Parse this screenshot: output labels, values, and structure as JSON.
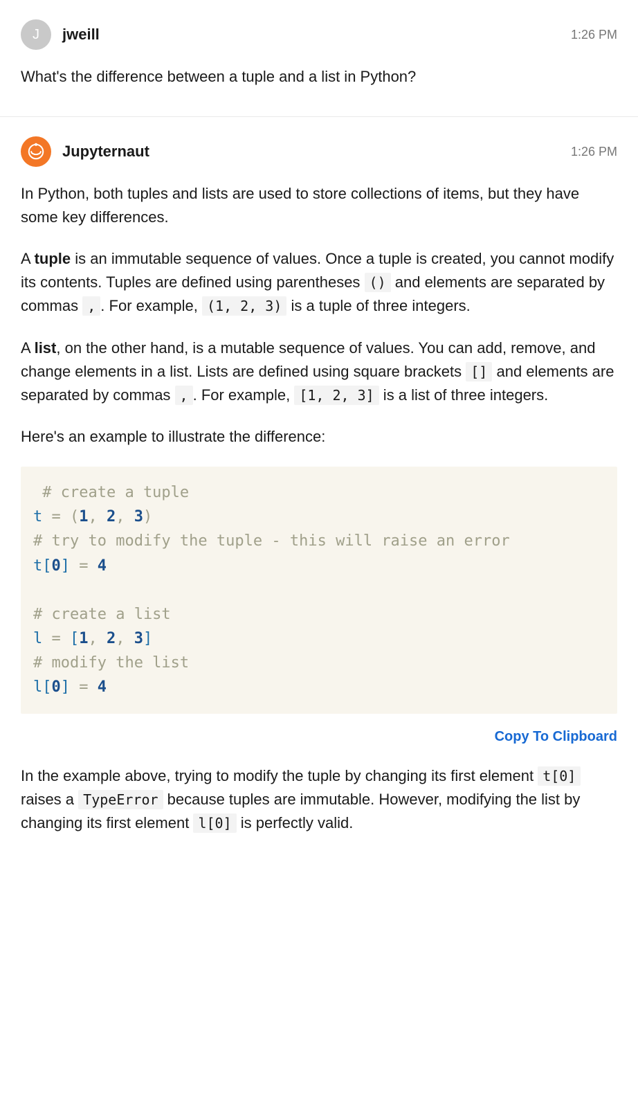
{
  "messages": [
    {
      "avatar_letter": "J",
      "username": "jweill",
      "timestamp": "1:26 PM",
      "question": "What's the difference between a tuple and a list in Python?"
    },
    {
      "username": "Jupyternaut",
      "timestamp": "1:26 PM",
      "p1": "In Python, both tuples and lists are used to store collections of items, but they have some key differences.",
      "p2a": "A ",
      "p2b": "tuple",
      "p2c": " is an immutable sequence of values. Once a tuple is created, you cannot modify its contents. Tuples are defined using parentheses ",
      "p2_code1": "()",
      "p2d": " and elements are separated by commas ",
      "p2_code2": ",",
      "p2e": ". For example, ",
      "p2_code3": "(1, 2, 3)",
      "p2f": " is a tuple of three integers.",
      "p3a": "A ",
      "p3b": "list",
      "p3c": ", on the other hand, is a mutable sequence of values. You can add, remove, and change elements in a list. Lists are defined using square brackets ",
      "p3_code1": "[]",
      "p3d": " and elements are separated by commas ",
      "p3_code2": ",",
      "p3e": ". For example, ",
      "p3_code3": "[1, 2, 3]",
      "p3f": " is a list of three integers.",
      "p4": "Here's an example to illustrate the difference:",
      "code": {
        "c1": " # create a tuple",
        "l2_v": "t",
        "l2_eq": " = ",
        "l2_lp": "(",
        "l2_n1": "1",
        "l2_s1": ", ",
        "l2_n2": "2",
        "l2_s2": ", ",
        "l2_n3": "3",
        "l2_rp": ")",
        "c3": "# try to modify the tuple - this will raise an error",
        "l4_v": "t",
        "l4_lb": "[",
        "l4_i": "0",
        "l4_rb": "]",
        "l4_eq": " = ",
        "l4_n": "4",
        "c6": "# create a list",
        "l7_v": "l",
        "l7_eq": " = ",
        "l7_lb": "[",
        "l7_n1": "1",
        "l7_s1": ", ",
        "l7_n2": "2",
        "l7_s2": ", ",
        "l7_n3": "3",
        "l7_rb": "]",
        "c8": "# modify the list",
        "l9_v": "l",
        "l9_lb": "[",
        "l9_i": "0",
        "l9_rb": "]",
        "l9_eq": " = ",
        "l9_n": "4"
      },
      "copy_label": "Copy To Clipboard",
      "p5a": "In the example above, trying to modify the tuple by changing its first element ",
      "p5_code1": "t[0]",
      "p5b": " raises a ",
      "p5_code2": "TypeError",
      "p5c": " because tuples are immutable. However, modifying the list by changing its first element ",
      "p5_code3": "l[0]",
      "p5d": " is perfectly valid."
    }
  ]
}
